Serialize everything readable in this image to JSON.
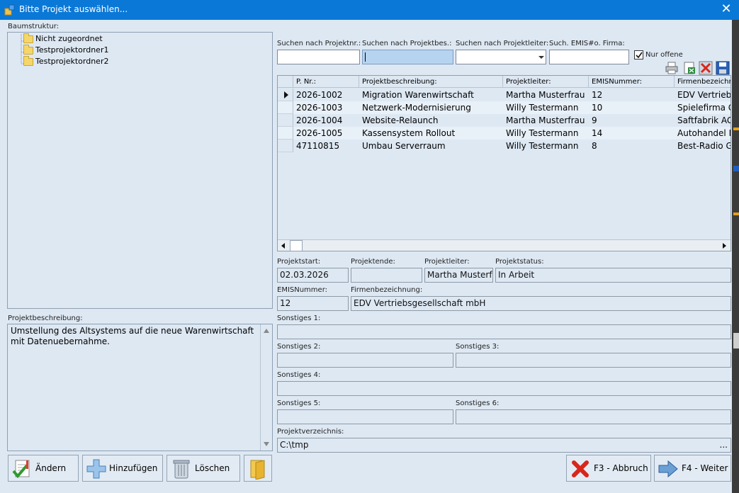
{
  "window": {
    "title": "Bitte Projekt auswählen..."
  },
  "tree": {
    "label": "Baumstruktur:",
    "items": [
      "Nicht zugeordnet",
      "Testprojektordner1",
      "Testprojektordner2"
    ]
  },
  "description": {
    "label": "Projektbeschreibung:",
    "text": "Umstellung des Altsystems auf die neue Warenwirtschaft mit Datenuebernahme."
  },
  "search": {
    "nr_label": "Suchen nach Projektnr.:",
    "beschr_label": "Suchen nach Projektbes.:",
    "leiter_label": "Suchen nach Projektleiter:",
    "emis_label": "Such. EMIS#o. Firma:",
    "nur_offene": "Nur offene",
    "nur_offene_checked": true
  },
  "grid": {
    "columns": [
      "P. Nr.:",
      "Projektbeschreibung:",
      "Projektleiter:",
      "EMISNummer:",
      "Firmenbezeichn"
    ],
    "rows": [
      {
        "nr": "2026-1002",
        "beschr": "Migration Warenwirtschaft",
        "leiter": "Martha Musterfrau",
        "emis": "12",
        "firma": "EDV Vertriebsg"
      },
      {
        "nr": "2026-1003",
        "beschr": "Netzwerk-Modernisierung",
        "leiter": "Willy Testermann",
        "emis": "10",
        "firma": "Spielefirma Gr"
      },
      {
        "nr": "2026-1004",
        "beschr": "Website-Relaunch",
        "leiter": "Martha Musterfrau",
        "emis": "9",
        "firma": "Saftfabrik AG"
      },
      {
        "nr": "2026-1005",
        "beschr": "Kassensystem Rollout",
        "leiter": "Willy Testermann",
        "emis": "14",
        "firma": "Autohandel Ba"
      },
      {
        "nr": "47110815",
        "beschr": "Umbau Serverraum",
        "leiter": "Willy Testermann",
        "emis": "8",
        "firma": "Best-Radio Gm"
      }
    ]
  },
  "details": {
    "projektstart_label": "Projektstart:",
    "projektstart": "02.03.2026",
    "projektende_label": "Projektende:",
    "projektende": "",
    "projektleiter_label": "Projektleiter:",
    "projektleiter": "Martha Musterfr",
    "projektstatus_label": "Projektstatus:",
    "projektstatus": "In Arbeit",
    "emis_label": "EMISNummer:",
    "emis": "12",
    "firma_label": "Firmenbezeichnung:",
    "firma": "EDV Vertriebsgesellschaft mbH",
    "sonst1_label": "Sonstiges 1:",
    "sonst1": "",
    "sonst2_label": "Sonstiges 2:",
    "sonst2": "",
    "sonst3_label": "Sonstiges 3:",
    "sonst3": "",
    "sonst4_label": "Sonstiges 4:",
    "sonst4": "",
    "sonst5_label": "Sonstiges 5:",
    "sonst5": "",
    "sonst6_label": "Sonstiges 6:",
    "sonst6": "",
    "verz_label": "Projektverzeichnis:",
    "verz": "C:\\tmp",
    "verz_browse": "..."
  },
  "buttons": {
    "aendern": "Ändern",
    "hinzufuegen": "Hinzufügen",
    "loeschen": "Löschen",
    "abbruch": "F3 - Abbruch",
    "weiter": "F4 - Weiter"
  },
  "colors": {
    "titlebar": "#0a78d7",
    "window": "#dde8f3",
    "selection": "#b6d3ef"
  }
}
